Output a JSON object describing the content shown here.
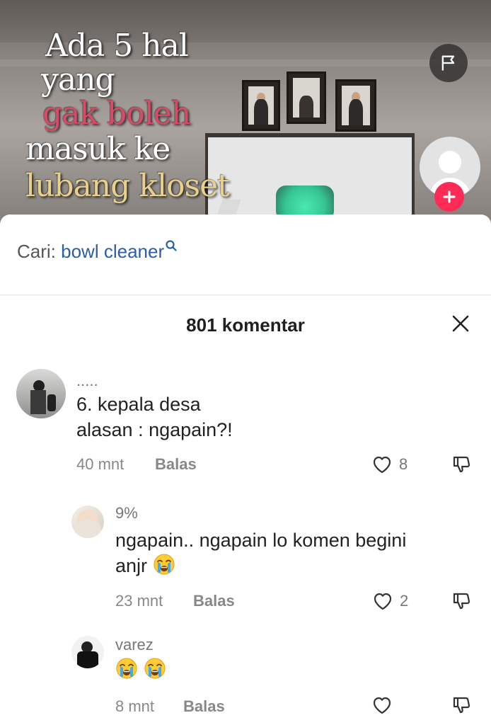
{
  "video": {
    "caption_lines": [
      {
        "text": "Ada 5 hal",
        "color": "#ffffff"
      },
      {
        "text": "yang",
        "color": "#ffffff"
      },
      {
        "text": "gak boleh",
        "color": "#d94a66"
      },
      {
        "text": "masuk ke",
        "color": "#ffffff"
      },
      {
        "text": "lubang kloset",
        "color": "#e9d08c"
      }
    ],
    "actions": {
      "report_icon": "flag-icon",
      "follow_icon": "plus-icon"
    }
  },
  "search": {
    "prefix": "Cari:",
    "term": "bowl cleaner",
    "icon": "search-icon"
  },
  "comments_header": {
    "title": "801 komentar",
    "close_icon": "close-icon"
  },
  "colors": {
    "accent": "#fe2c55",
    "link": "#2b5ea7"
  },
  "comments": [
    {
      "username": ".....",
      "lines": [
        "6. kepala desa",
        "alasan : ngapain?!"
      ],
      "time": "40 mnt",
      "reply_label": "Balas",
      "likes": "8"
    },
    {
      "username": "9%",
      "lines": [
        "ngapain.. ngapain lo komen begini",
        "anjr"
      ],
      "emoji": "loudly-crying-face",
      "time": "23 mnt",
      "reply_label": "Balas",
      "likes": "2"
    },
    {
      "username": "varez",
      "emoji_count": 2,
      "emoji": "loudly-crying-face",
      "time": "8 mnt",
      "reply_label": "Balas",
      "likes": ""
    }
  ]
}
